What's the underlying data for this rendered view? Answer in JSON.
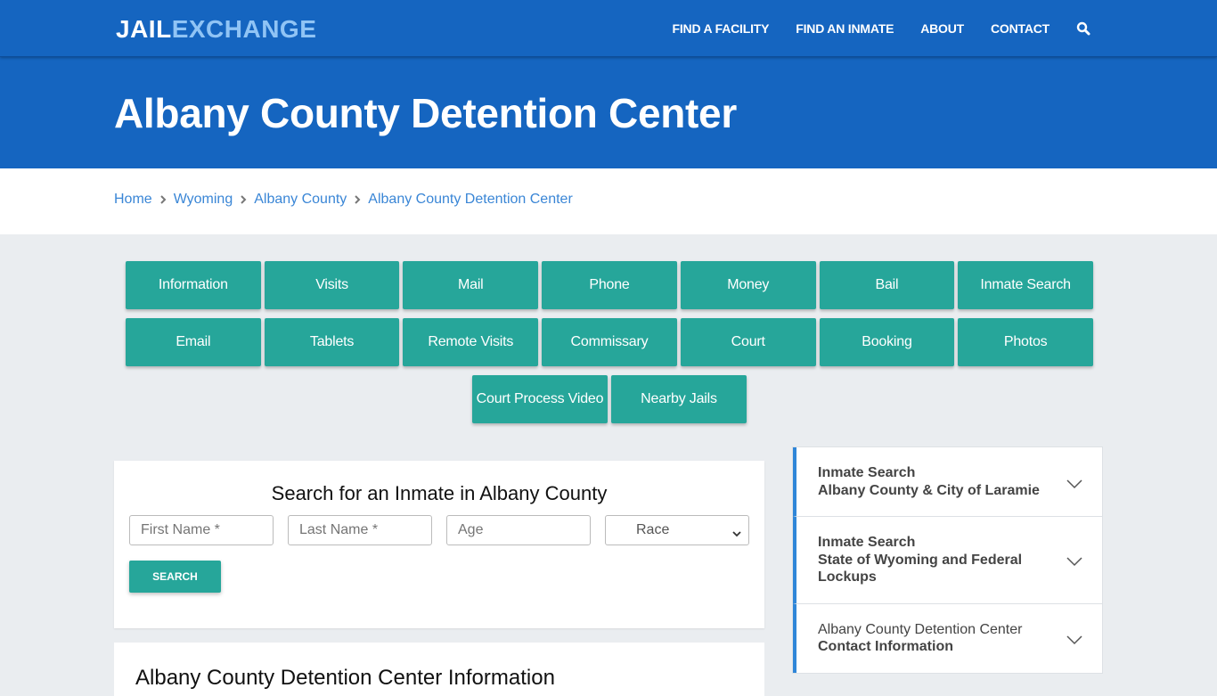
{
  "brand": {
    "part1": "JAIL",
    "part2": "EXCHANGE"
  },
  "nav": {
    "items": [
      "FIND A FACILITY",
      "FIND AN INMATE",
      "ABOUT",
      "CONTACT"
    ],
    "search_icon": "search-icon"
  },
  "hero": {
    "title": "Albany County Detention Center"
  },
  "breadcrumb": [
    "Home",
    "Wyoming",
    "Albany County",
    "Albany County Detention Center"
  ],
  "tabs": {
    "row1": [
      "Information",
      "Visits",
      "Mail",
      "Phone",
      "Money",
      "Bail",
      "Inmate Search"
    ],
    "row2": [
      "Email",
      "Tablets",
      "Remote Visits",
      "Commissary",
      "Court",
      "Booking",
      "Photos"
    ],
    "row3": [
      "Court Process Video",
      "Nearby Jails"
    ]
  },
  "search": {
    "title": "Search for an Inmate in Albany County",
    "first_name_placeholder": "First Name *",
    "last_name_placeholder": "Last Name *",
    "age_placeholder": "Age",
    "race_selected": "Race",
    "button": "SEARCH"
  },
  "info": {
    "title": "Albany County Detention Center Information"
  },
  "sidebar": [
    {
      "line1": "Inmate Search",
      "line2": "Albany County & City of Laramie",
      "line1_bold": true
    },
    {
      "line1": "Inmate Search",
      "line2": "State of Wyoming and Federal Lockups",
      "line1_bold": true
    },
    {
      "line1": "Albany County Detention Center",
      "line2": "Contact Information",
      "line1_bold": false
    }
  ],
  "colors": {
    "header": "#1565c0",
    "accent_teal": "#26a69a",
    "link": "#3a86d6",
    "logo_light": "#90c4f5"
  }
}
